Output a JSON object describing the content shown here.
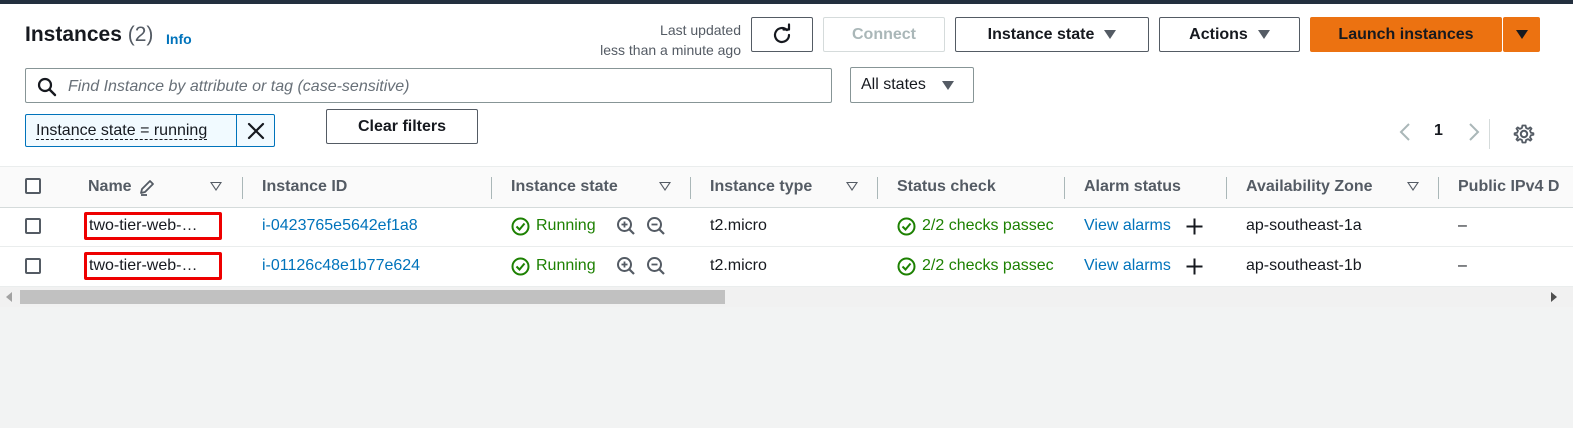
{
  "header": {
    "title": "Instances",
    "count": "(2)",
    "info_link": "Info",
    "last_updated_line1": "Last updated",
    "last_updated_line2": "less than a minute ago"
  },
  "toolbar": {
    "refresh_icon": "refresh-icon",
    "connect_label": "Connect",
    "instance_state_label": "Instance state",
    "actions_label": "Actions",
    "launch_label": "Launch instances"
  },
  "search": {
    "placeholder": "Find Instance by attribute or tag (case-sensitive)",
    "value": ""
  },
  "state_filter": {
    "selected": "All states"
  },
  "filter_token": {
    "label": "Instance state = running"
  },
  "clear_filters_label": "Clear filters",
  "pagination": {
    "current_page": "1"
  },
  "table": {
    "columns": [
      "Name",
      "Instance ID",
      "Instance state",
      "Instance type",
      "Status check",
      "Alarm status",
      "Availability Zone",
      "Public IPv4 D"
    ],
    "rows": [
      {
        "name": "two-tier-web-…",
        "instance_id": "i-0423765e5642ef1a8",
        "state": "Running",
        "type": "t2.micro",
        "status_check": "2/2 checks passec",
        "alarm": "View alarms",
        "az": "ap-southeast-1a",
        "public_ipv4": "–"
      },
      {
        "name": "two-tier-web-…",
        "instance_id": "i-01126c48e1b77e624",
        "state": "Running",
        "type": "t2.micro",
        "status_check": "2/2 checks passec",
        "alarm": "View alarms",
        "az": "ap-southeast-1b",
        "public_ipv4": "–"
      }
    ]
  },
  "colors": {
    "primary_button": "#ec7211",
    "link": "#0073bb",
    "success": "#1d8102",
    "highlight_border": "#e00000"
  }
}
